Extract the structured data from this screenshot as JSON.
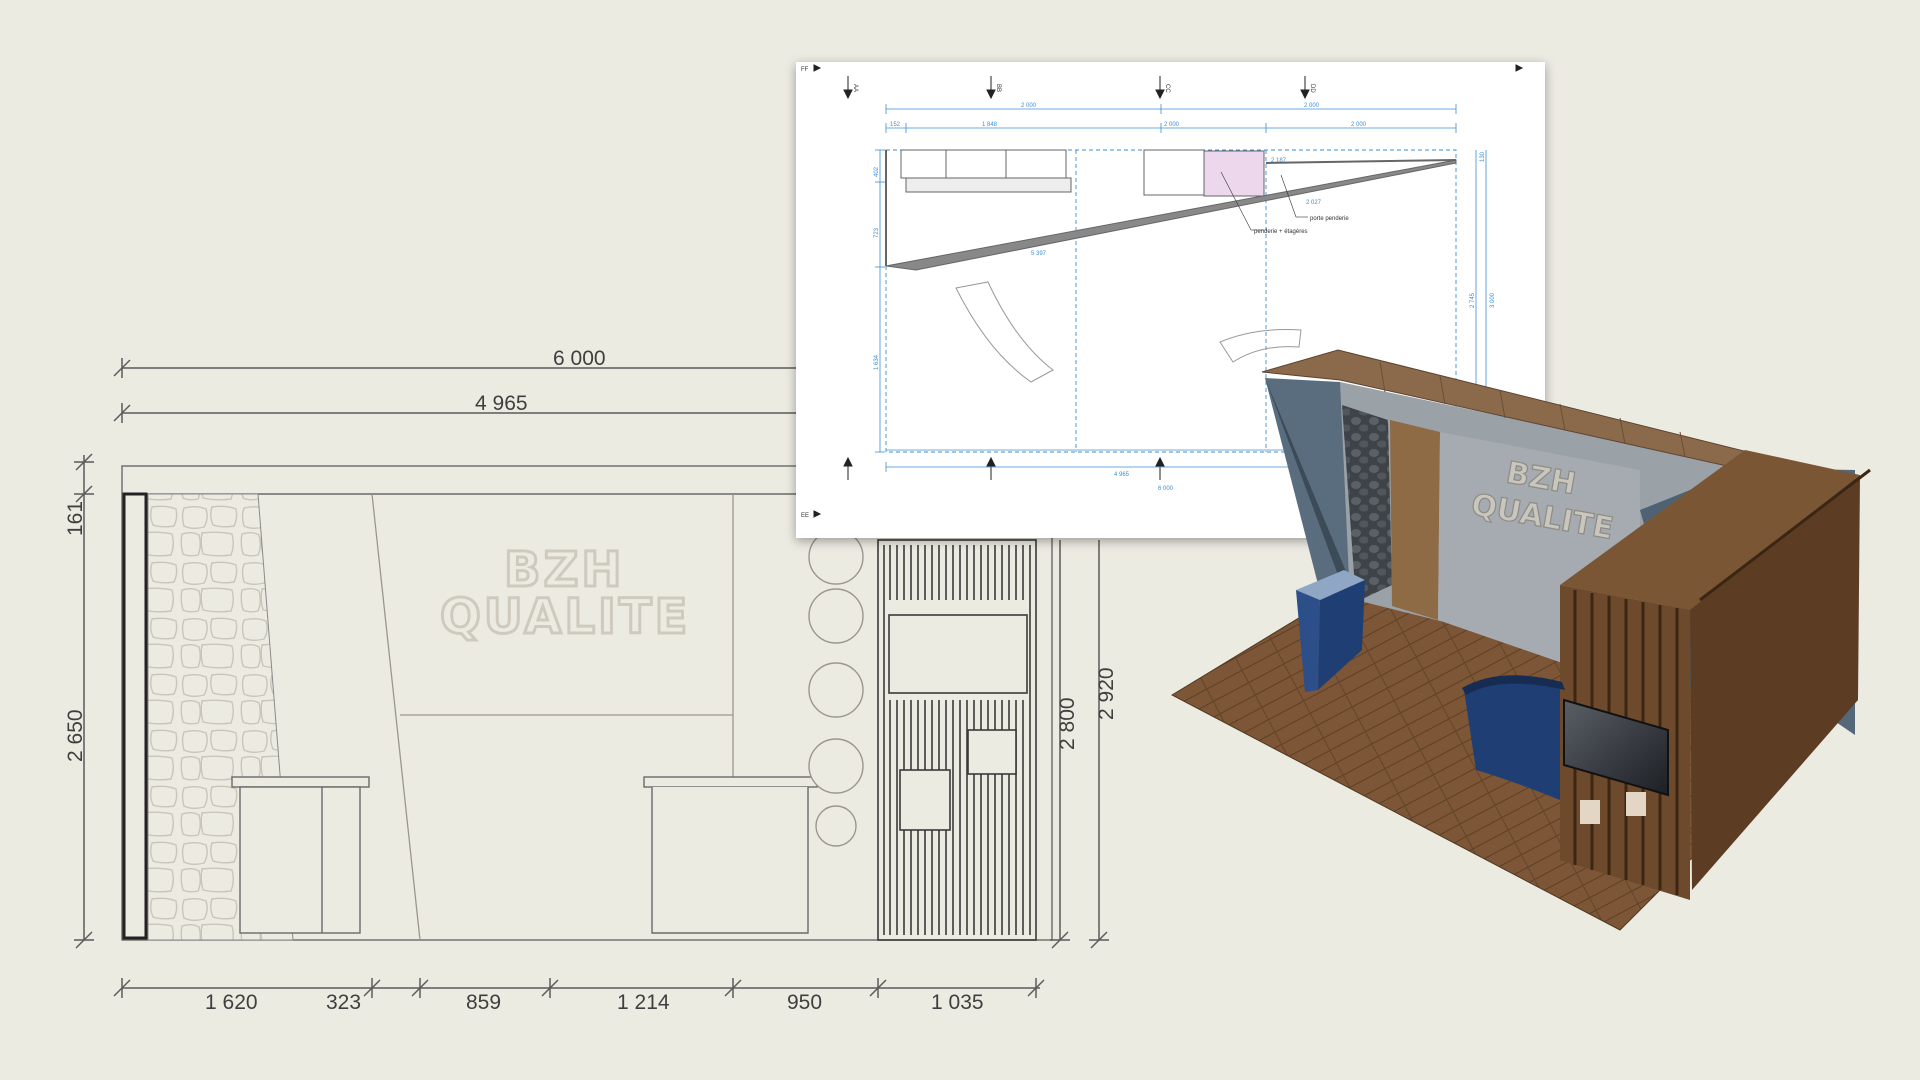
{
  "elevation": {
    "overall_dims": [
      "6 000",
      "4 965"
    ],
    "left_dims": [
      "161",
      "2 650"
    ],
    "right_dims": [
      "2 800",
      "2 920"
    ],
    "bottom_dims": [
      "1 620",
      "323",
      "859",
      "1 214",
      "950",
      "1 035"
    ],
    "logo": {
      "line1": "BZH",
      "line2": "QUALITE"
    }
  },
  "plan": {
    "section_marks": [
      "AA",
      "BB",
      "CC",
      "DD",
      "EE",
      "FF"
    ],
    "top_dims": [
      "2 000",
      "2 000"
    ],
    "second_row_dims": [
      "152",
      "1 848",
      "2 000",
      "2 000"
    ],
    "side_dims": [
      "402",
      "723",
      "1 634",
      "2 745",
      "3 000",
      "130"
    ],
    "slant_dims": [
      "2 027",
      "2 187",
      "5 397"
    ],
    "bottom_dims": [
      "4 965",
      "6 000"
    ],
    "labels": {
      "penderie_etageres": "penderie + étagères",
      "porte_penderie": "porte penderie"
    }
  },
  "render3d": {
    "logo": {
      "line1": "BZH",
      "line2": "QUALITE"
    }
  },
  "colors": {
    "background": "#ecebe2",
    "drawing_line": "#5b5b5b",
    "plan_blue": "#3b8fd6",
    "plan_pink": "#ecd7ec",
    "floor_wood": "#7a5634",
    "wall_blue_grey": "#4f6273",
    "counter_blue": "#1f3f74"
  }
}
